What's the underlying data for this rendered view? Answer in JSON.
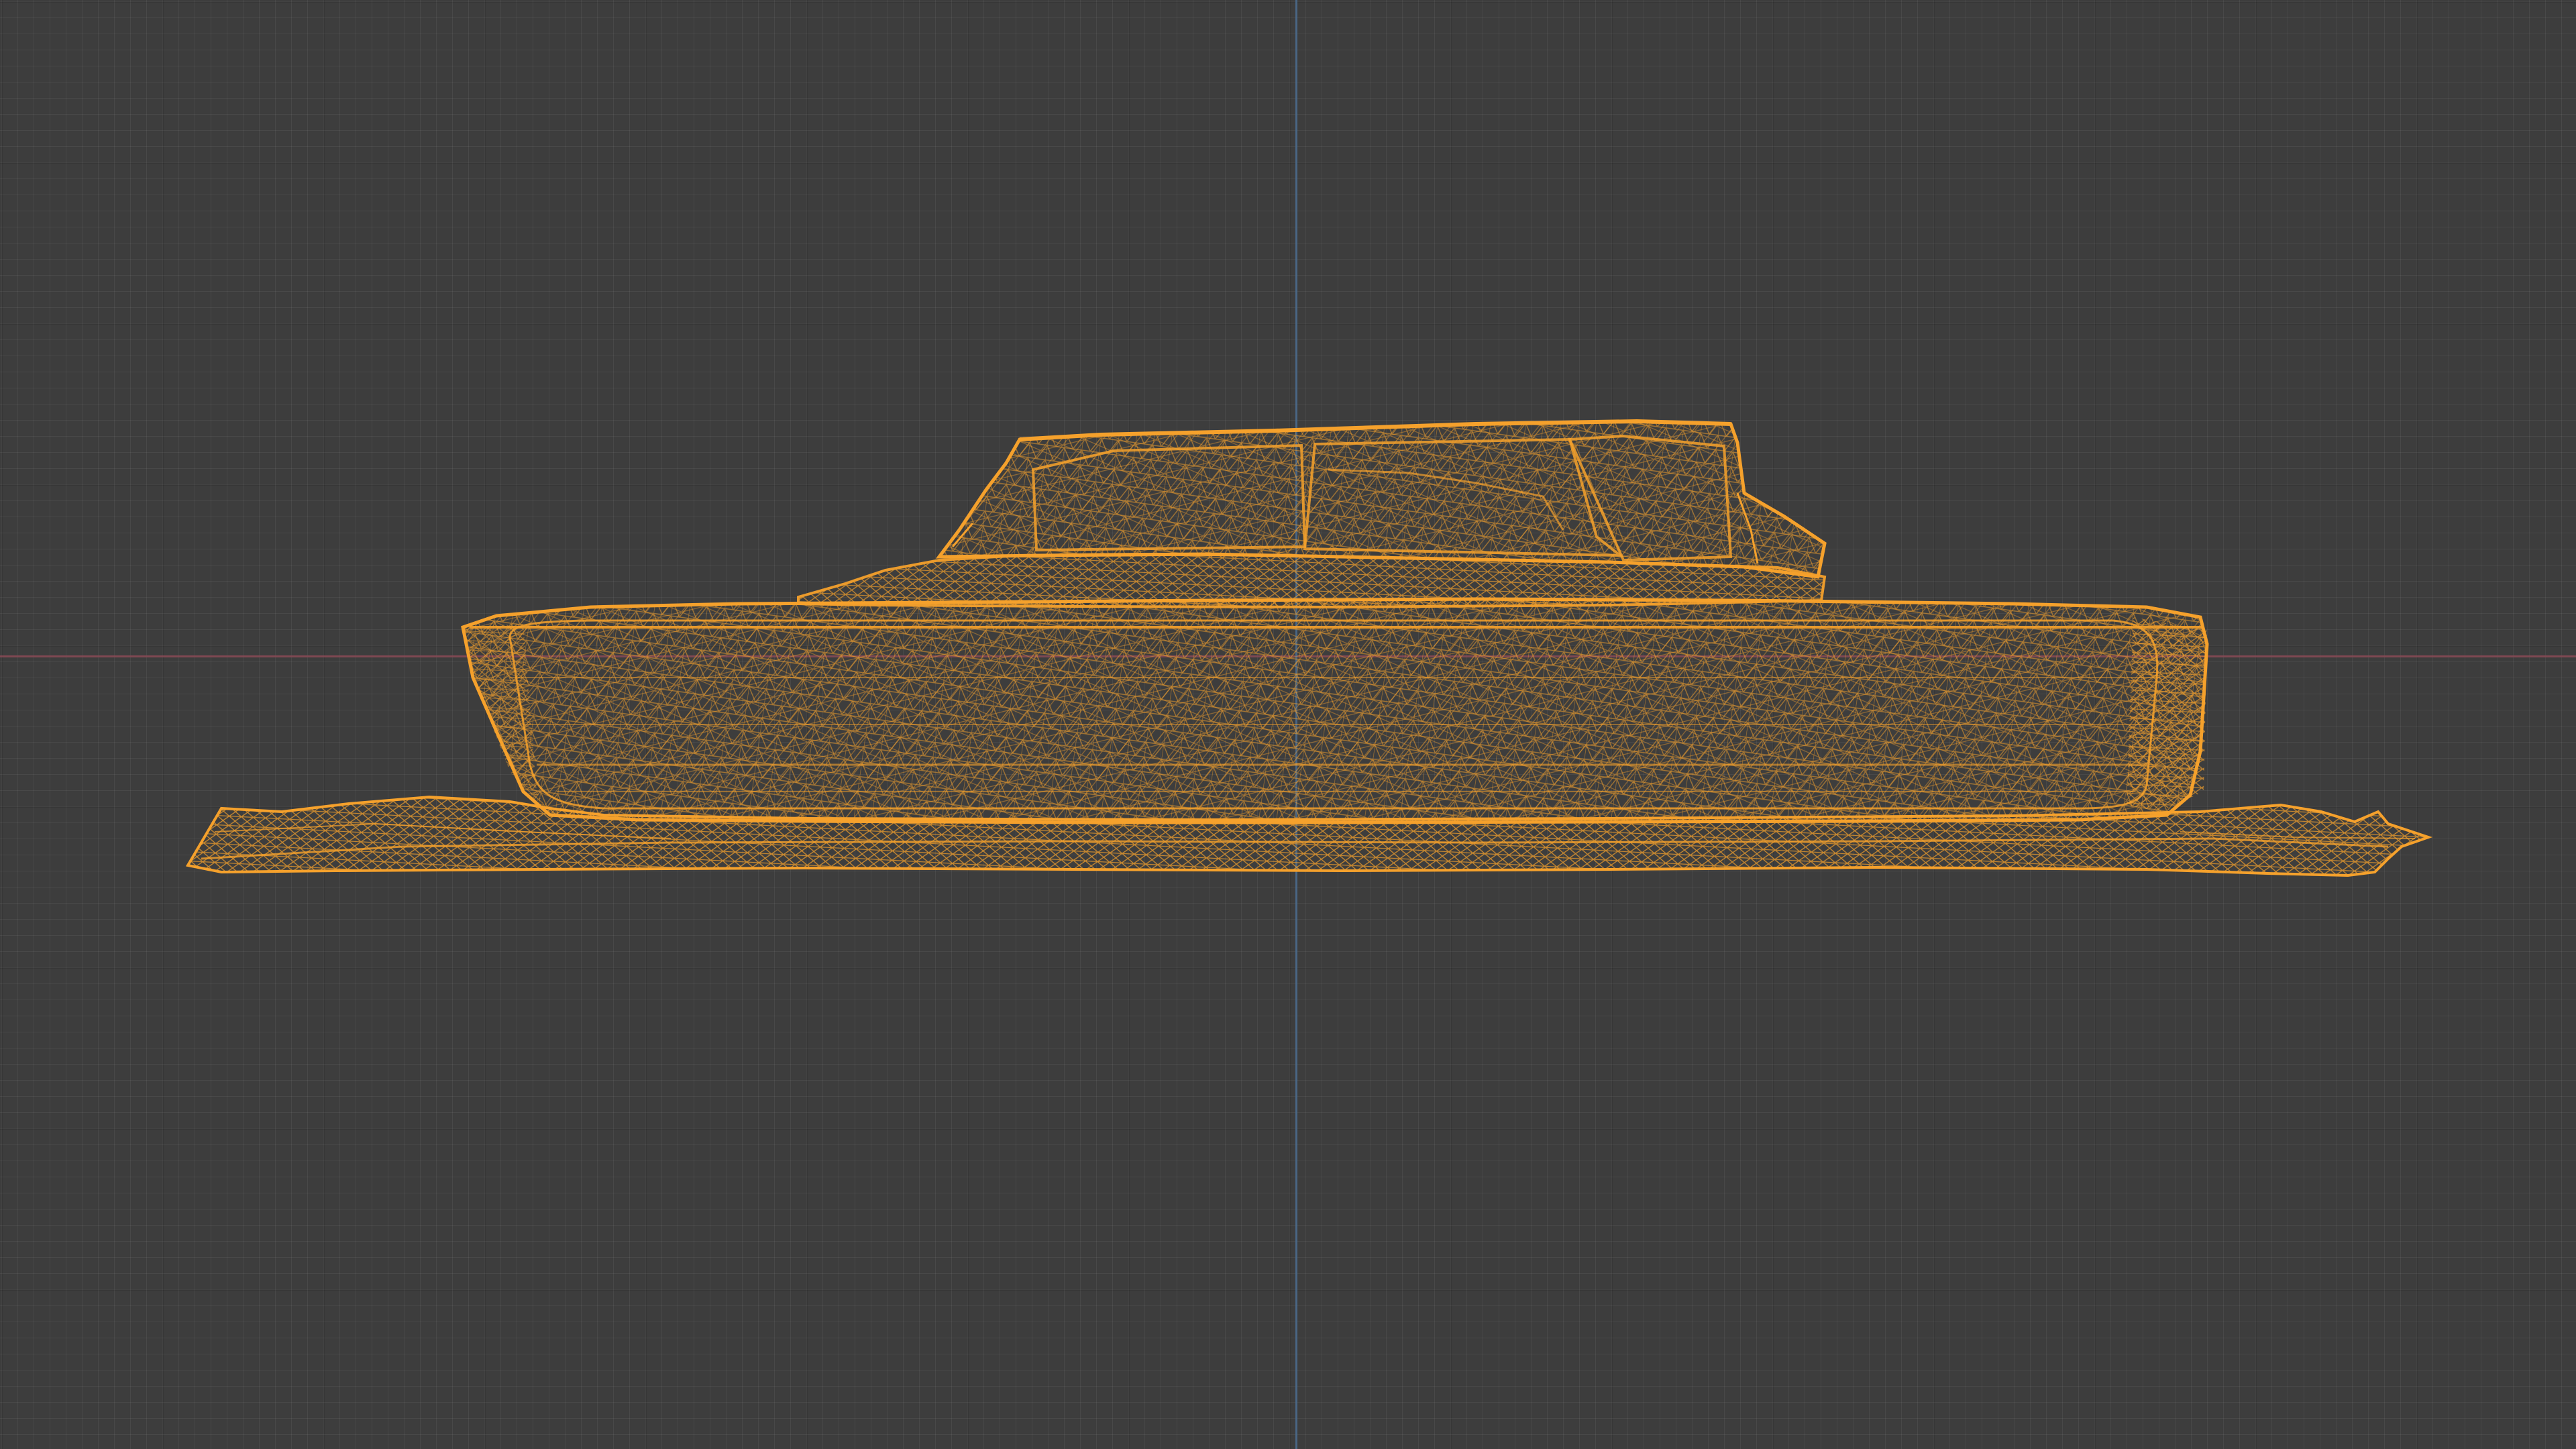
{
  "viewport": {
    "view_type": "3d-viewport",
    "shading": "wireframe",
    "background_color": "#3d3d3d"
  },
  "axes": {
    "x_axis_color": "#8a4a56",
    "y_axis_color": "#4a6a8c"
  },
  "object": {
    "type": "mesh",
    "wire_color": "#f5a12c",
    "selected": true
  }
}
